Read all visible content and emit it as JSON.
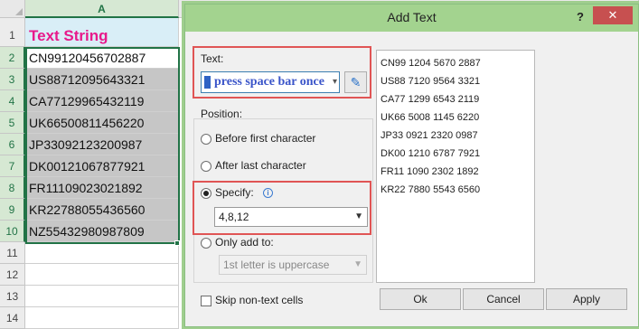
{
  "sheet": {
    "column": "A",
    "rows": [
      "1",
      "2",
      "3",
      "4",
      "5",
      "6",
      "7",
      "8",
      "9",
      "10",
      "11",
      "12",
      "13",
      "14"
    ],
    "header": "Text String",
    "cells": [
      "CN99120456702887",
      "US88712095643321",
      "CA77129965432119",
      "UK66500811456220",
      "JP33092123200987",
      "DK00121067877921",
      "FR11109023021892",
      "KR22788055436560",
      "NZ55432980987809"
    ]
  },
  "dialog": {
    "title": "Add Text",
    "help": "?",
    "close": "✕",
    "text_label": "Text:",
    "text_value": "press space bar once",
    "position_label": "Position:",
    "options": {
      "before": "Before first character",
      "after": "After last character",
      "specify": "Specify:",
      "only_add": "Only add to:"
    },
    "specify_value": "4,8,12",
    "only_add_value": "1st letter is uppercase",
    "skip_label": "Skip non-text cells",
    "preview": [
      "CN99 1204 5670 2887",
      "US88 7120 9564 3321",
      "CA77 1299 6543 2119",
      "UK66 5008 1145 6220",
      "JP33 0921 2320 0987",
      "DK00 1210 6787 7921",
      "FR11 1090 2302 1892",
      "KR22 7880 5543 6560"
    ],
    "buttons": {
      "ok": "Ok",
      "cancel": "Cancel",
      "apply": "Apply"
    },
    "selected_option": "specify"
  }
}
